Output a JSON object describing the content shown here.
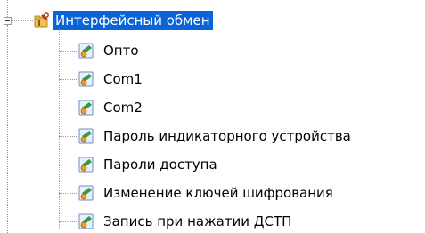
{
  "tree": {
    "root": {
      "label": "Интерфейсный обмен",
      "icon": "tools-folder-icon",
      "expanded": true,
      "selected": true,
      "selection_color": "#0a64d8"
    },
    "items": [
      {
        "label": "Опто",
        "icon": "settings-item-icon"
      },
      {
        "label": "Com1",
        "icon": "settings-item-icon"
      },
      {
        "label": "Com2",
        "icon": "settings-item-icon"
      },
      {
        "label": "Пароль индикаторного устройства",
        "icon": "settings-item-icon"
      },
      {
        "label": "Пароли доступа",
        "icon": "settings-item-icon"
      },
      {
        "label": "Изменение ключей шифрования",
        "icon": "settings-item-icon"
      },
      {
        "label": "Запись при нажатии ДСТП",
        "icon": "settings-item-icon"
      }
    ]
  }
}
